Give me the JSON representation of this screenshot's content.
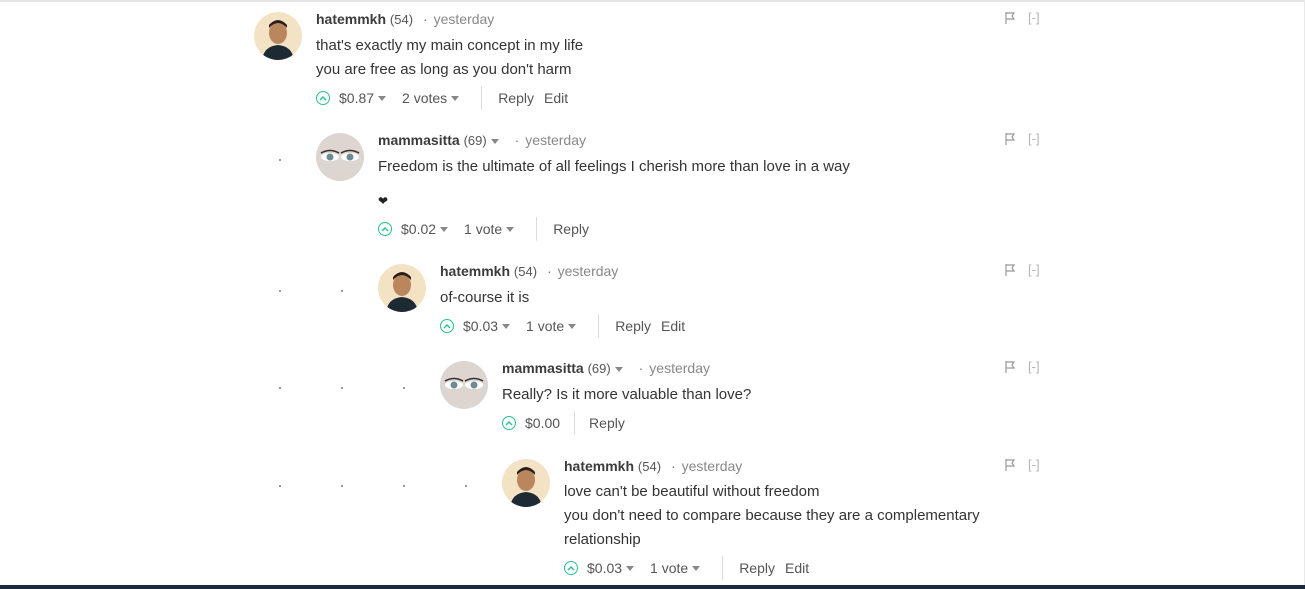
{
  "comments": [
    {
      "author": "hatemmkh",
      "reputation": "(54)",
      "separator": "·",
      "time": "yesterday",
      "lines": [
        "that's exactly my main concept in my life",
        "you are free as long as you don't harm"
      ],
      "payout": "$0.87",
      "votes": "2 votes",
      "reply_label": "Reply",
      "edit_label": "Edit",
      "collapse_label": "[-]"
    },
    {
      "author": "mammasitta",
      "reputation": "(69)",
      "separator": "·",
      "time": "yesterday",
      "lines": [
        "Freedom is the ultimate of all feelings I cherish more than love in a way",
        "",
        "❤"
      ],
      "payout": "$0.02",
      "votes": "1 vote",
      "reply_label": "Reply",
      "collapse_label": "[-]"
    },
    {
      "author": "hatemmkh",
      "reputation": "(54)",
      "separator": "·",
      "time": "yesterday",
      "lines": [
        "of-course it is"
      ],
      "payout": "$0.03",
      "votes": "1 vote",
      "reply_label": "Reply",
      "edit_label": "Edit",
      "collapse_label": "[-]"
    },
    {
      "author": "mammasitta",
      "reputation": "(69)",
      "separator": "·",
      "time": "yesterday",
      "lines": [
        "Really? Is it more valuable than love?"
      ],
      "payout": "$0.00",
      "reply_label": "Reply",
      "collapse_label": "[-]"
    },
    {
      "author": "hatemmkh",
      "reputation": "(54)",
      "separator": "·",
      "time": "yesterday",
      "lines": [
        "love can't be beautiful without freedom",
        "you don't need to compare because they are a complementary",
        "relationship"
      ],
      "payout": "$0.03",
      "votes": "1 vote",
      "reply_label": "Reply",
      "edit_label": "Edit",
      "collapse_label": "[-]"
    }
  ],
  "colors": {
    "upvote": "#26c18f",
    "footer_bar": "#1a2a38"
  }
}
